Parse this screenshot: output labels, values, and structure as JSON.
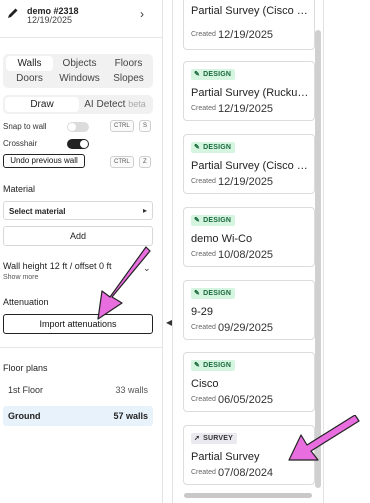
{
  "header": {
    "title": "demo #2318",
    "date": "12/19/2025",
    "edit_icon": "pencil-icon",
    "chevron_icon": "chevron-right-icon"
  },
  "tool_tabs": [
    {
      "label": "Walls",
      "active": true
    },
    {
      "label": "Objects",
      "active": false
    },
    {
      "label": "Floors",
      "active": false
    },
    {
      "label": "Doors",
      "active": false
    },
    {
      "label": "Windows",
      "active": false
    },
    {
      "label": "Slopes",
      "active": false
    }
  ],
  "mode_tabs": {
    "draw": "Draw",
    "ai_detect": "AI Detect",
    "beta": "beta"
  },
  "snap_to_wall": {
    "label": "Snap to wall",
    "enabled": false,
    "key_mod": "CTRL",
    "key": "S"
  },
  "crosshair": {
    "label": "Crosshair",
    "enabled": true
  },
  "undo": {
    "label": "Undo previous wall",
    "key_mod": "CTRL",
    "key": "Z"
  },
  "material": {
    "label": "Material",
    "select_value": "Select material",
    "add_label": "Add"
  },
  "wall_height": {
    "text": "Wall height 12 ft / offset 0 ft",
    "show_more": "Show more"
  },
  "attenuation": {
    "label": "Attenuation",
    "import_label": "Import attenuations"
  },
  "floor_plans": {
    "label": "Floor plans",
    "items": [
      {
        "name": "1st Floor",
        "count": "33 walls",
        "active": false
      },
      {
        "name": "Ground",
        "count": "57 walls",
        "active": true
      }
    ]
  },
  "created_label": "Created",
  "cards": [
    {
      "badge": "DESIGN",
      "name": "Partial Survey (Cisco CW...",
      "date": "12/19/2025"
    },
    {
      "badge": "DESIGN",
      "name": "Partial Survey (Ruckus R...",
      "date": "12/19/2025"
    },
    {
      "badge": "DESIGN",
      "name": "Partial Survey (Cisco CW...",
      "date": "12/19/2025"
    },
    {
      "badge": "DESIGN",
      "name": "demo Wi-Co",
      "date": "10/08/2025"
    },
    {
      "badge": "DESIGN",
      "name": "9-29",
      "date": "09/29/2025"
    },
    {
      "badge": "DESIGN",
      "name": "Cisco",
      "date": "06/05/2025"
    },
    {
      "badge": "SURVEY",
      "name": "Partial Survey",
      "date": "07/08/2024"
    }
  ],
  "colors": {
    "design_badge_bg": "#d6f5e0",
    "design_badge_text": "#17683a",
    "survey_badge_bg": "#e9e9ef",
    "arrow": "#e86ee0",
    "active_floor_bg": "#e8f2fb"
  }
}
